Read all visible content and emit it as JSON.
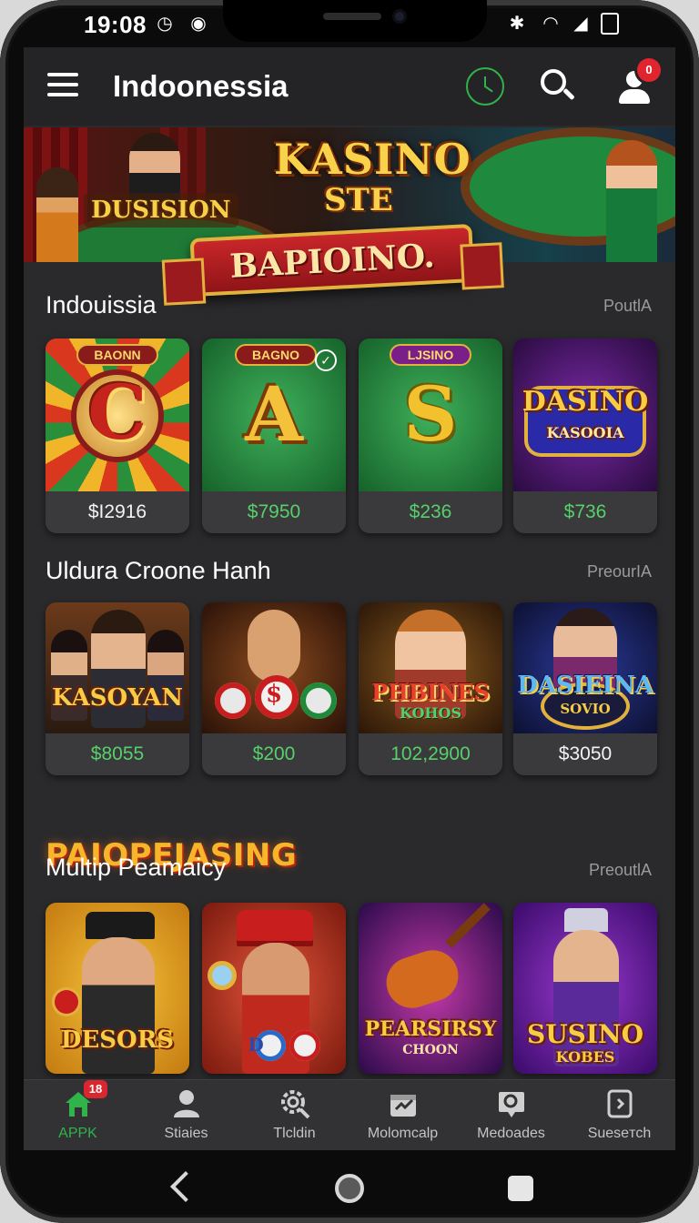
{
  "status_bar": {
    "time": "19:08"
  },
  "app_bar": {
    "title": "Indoonessia",
    "profile_badge": "0"
  },
  "banner": {
    "left_sign": "DUSISION",
    "headline": "KASINO",
    "subline": "STE",
    "ribbon": "BAPIOINO."
  },
  "sections": [
    {
      "title": "Indouissia",
      "link": "PoutlA",
      "cards": [
        {
          "tag": "BAONN",
          "art_text": "C",
          "price": "$I2916",
          "price_color": "white"
        },
        {
          "tag": "BAGNO",
          "art_text": "A",
          "price": "$7950",
          "price_color": "green"
        },
        {
          "tag": "LJSINO",
          "art_text": "S",
          "price": "$236",
          "price_color": "green"
        },
        {
          "tag": "",
          "art_text": "DASINO",
          "sub_text": "KASOOIA",
          "price": "$736",
          "price_color": "green"
        }
      ]
    },
    {
      "title": "Uldura Croone Hanh",
      "link": "PreourIA",
      "cards": [
        {
          "art_text": "KASOYAN",
          "price": "$8055",
          "price_color": "green"
        },
        {
          "art_text": "$",
          "price": "$200",
          "price_color": "green"
        },
        {
          "art_text": "PHBINES",
          "sub_text": "KOHOS",
          "price": "102,2900",
          "price_color": "green"
        },
        {
          "art_text": "DASIEINA",
          "sub_text": "SOVIO",
          "price": "$3050",
          "price_color": "white"
        }
      ]
    },
    {
      "title": "Multip Peamaicy",
      "link": "PreoutlA",
      "cards": [
        {
          "art_text": "DESORS"
        },
        {
          "art_text": "D"
        },
        {
          "art_text": "PEARSIRSY",
          "sub_text": "CHOON"
        },
        {
          "art_text": "SUSINO",
          "sub_text": "KOBES"
        }
      ]
    }
  ],
  "promo_heading": "PAIOPEJASING",
  "bottom_nav": [
    {
      "label": "APPK",
      "icon": "home-icon",
      "badge": "18",
      "active": true
    },
    {
      "label": "Stiaies",
      "icon": "person-icon"
    },
    {
      "label": "Tlcldin",
      "icon": "gear-search-icon"
    },
    {
      "label": "Molomcalp",
      "icon": "calendar-icon"
    },
    {
      "label": "Medoades",
      "icon": "message-icon"
    },
    {
      "label": "Sueseтch",
      "icon": "tablet-icon"
    }
  ],
  "colors": {
    "accent_green": "#2fb34a",
    "price_green": "#56d06a",
    "promo_orange": "#f7b52c",
    "badge_red": "#e1252f",
    "screen_bg": "#2a2a2c"
  }
}
